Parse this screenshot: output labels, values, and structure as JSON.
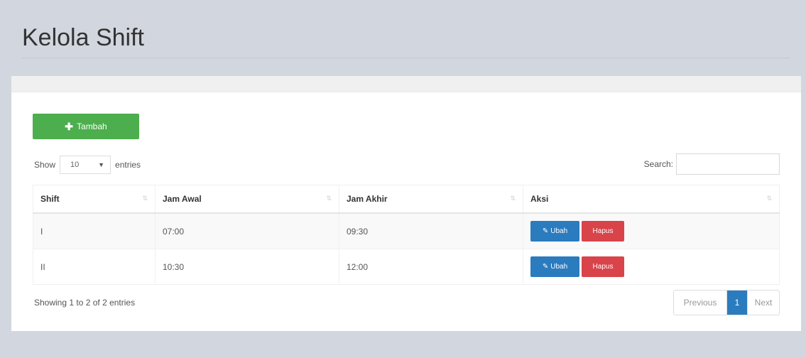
{
  "page": {
    "title": "Kelola Shift"
  },
  "toolbar": {
    "add_icon": "plus-icon",
    "add_label": "Tambah"
  },
  "length": {
    "show_label": "Show",
    "value": "10",
    "entries_label": "entries"
  },
  "search": {
    "label": "Search:",
    "value": ""
  },
  "table": {
    "headers": [
      "Shift",
      "Jam Awal",
      "Jam Akhir",
      "Aksi"
    ],
    "rows": [
      {
        "shift": "I",
        "jam_awal": "07:00",
        "jam_akhir": "09:30"
      },
      {
        "shift": "II",
        "jam_awal": "10:30",
        "jam_akhir": "12:00"
      }
    ],
    "edit_icon": "edit-icon",
    "edit_label": "Ubah",
    "delete_label": "Hapus"
  },
  "footer": {
    "info": "Showing 1 to 2 of 2 entries"
  },
  "pagination": {
    "previous": "Previous",
    "page": "1",
    "next": "Next"
  },
  "colors": {
    "background": "#d2d6de",
    "success": "#4cae4c",
    "primary": "#2b7bbf",
    "danger": "#d9434a"
  }
}
